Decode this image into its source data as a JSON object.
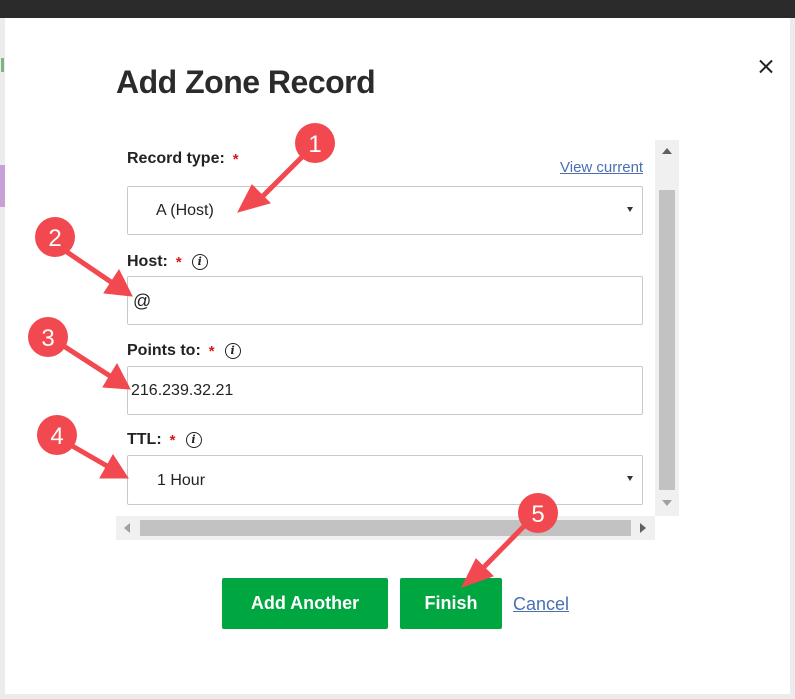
{
  "dialog": {
    "title": "Add Zone Record",
    "view_current_link": "View current",
    "fields": {
      "record_type": {
        "label": "Record type:",
        "required_mark": "*",
        "value": "A (Host)"
      },
      "host": {
        "label": "Host:",
        "required_mark": "*",
        "info_glyph": "i",
        "value": "@"
      },
      "points_to": {
        "label": "Points to:",
        "required_mark": "*",
        "info_glyph": "i",
        "value": "216.239.32.21"
      },
      "ttl": {
        "label": "TTL:",
        "required_mark": "*",
        "info_glyph": "i",
        "value": "1 Hour"
      }
    },
    "buttons": {
      "add_another": "Add Another",
      "finish": "Finish",
      "cancel": "Cancel"
    }
  },
  "annotations": {
    "color": "#f2484f",
    "steps": [
      "1",
      "2",
      "3",
      "4",
      "5"
    ]
  },
  "colors": {
    "primary_button": "#00a63f",
    "link": "#4a6fb3",
    "required": "#d9161d"
  }
}
